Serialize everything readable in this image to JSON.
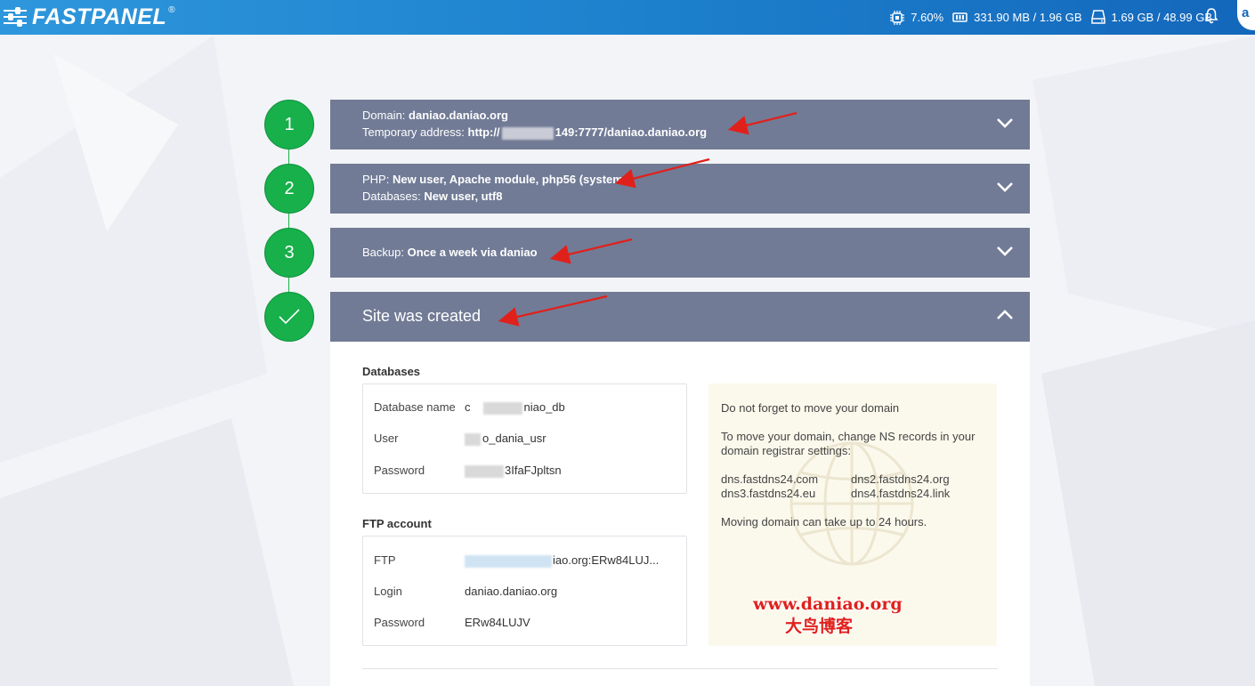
{
  "header": {
    "logo_text": "FASTPANEL",
    "logo_mark": "®",
    "cpu": "7.60%",
    "ram": "331.90 MB / 1.96 GB",
    "disk": "1.69 GB / 48.99 GB",
    "user_initial": "a"
  },
  "steps": [
    {
      "number": "1",
      "lines": [
        {
          "label": "Domain: ",
          "value": "daniao.daniao.org"
        },
        {
          "label": "Temporary address: ",
          "value_prefix": "http://",
          "value_suffix": "149:7777/daniao.daniao.org"
        }
      ]
    },
    {
      "number": "2",
      "lines": [
        {
          "label": "PHP: ",
          "value": "New user, Apache module, php56 (system"
        },
        {
          "label": "Databases: ",
          "value": "New user, utf8"
        }
      ]
    },
    {
      "number": "3",
      "lines": [
        {
          "label": "Backup: ",
          "value": "Once a week via daniao"
        }
      ]
    },
    {
      "number": "",
      "title": "Site was created"
    }
  ],
  "databases": {
    "title": "Databases",
    "rows": [
      {
        "key": "Database name",
        "value_prefix": "c",
        "value": "niao_db"
      },
      {
        "key": "User",
        "value": "o_dania_usr"
      },
      {
        "key": "Password",
        "value": "3IfaFJpltsn"
      }
    ]
  },
  "ftp": {
    "title": "FTP account",
    "rows": [
      {
        "key": "FTP",
        "value": "iao.org:ERw84LUJ..."
      },
      {
        "key": "Login",
        "value": "daniao.daniao.org"
      },
      {
        "key": "Password",
        "value": "ERw84LUJV"
      }
    ]
  },
  "info": {
    "line1": "Do not forget to move your domain",
    "line2a": "To move your domain, change NS records in your",
    "line2b": "domain registrar settings:",
    "ns": [
      "dns.fastdns24.com",
      "dns2.fastdns24.org",
      "dns3.fastdns24.eu",
      "dns4.fastdns24.link"
    ],
    "line3": "Moving domain can take up to 24 hours.",
    "watermark_url": "www.daniao.org",
    "watermark_cn": "大鸟博客"
  },
  "colors": {
    "header": "#1c7fcc",
    "step_green": "#17b04b",
    "panel": "#717b96",
    "arrow": "#e0211b"
  }
}
